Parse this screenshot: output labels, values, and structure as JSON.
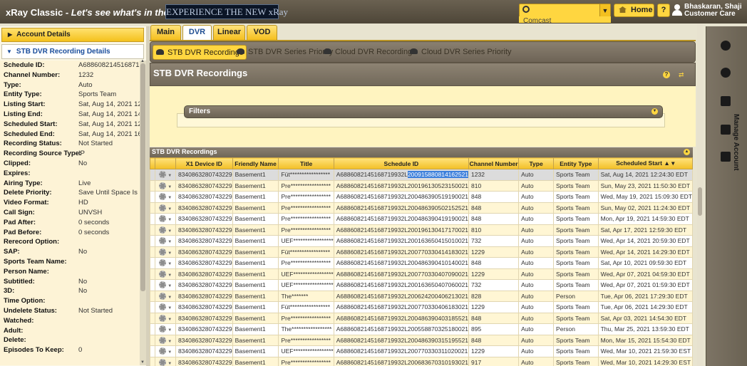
{
  "topbar": {
    "app_name": "xRay Classic",
    "tagline": "Let's see what's in there",
    "banner": "EXPERIENCE THE NEW xRay",
    "search_value": "",
    "search_sub": "Comcast",
    "home_label": "Home",
    "help_label": "?",
    "user_name": "Bhaskaran, Shaji",
    "user_role": "Customer Care"
  },
  "sidebar": {
    "account_label": "Account Details",
    "section_label": "STB DVR Recording Details",
    "details": [
      {
        "label": "Schedule ID:",
        "value": "A6886082145168719..."
      },
      {
        "label": "Channel Number:",
        "value": "1232"
      },
      {
        "label": "Type:",
        "value": "Auto"
      },
      {
        "label": "Entity Type:",
        "value": "Sports Team"
      },
      {
        "label": "Listing Start:",
        "value": "Sat, Aug 14, 2021 12:..."
      },
      {
        "label": "Listing End:",
        "value": "Sat, Aug 14, 2021 14:..."
      },
      {
        "label": "Scheduled Start:",
        "value": "Sat, Aug 14, 2021 12:..."
      },
      {
        "label": "Scheduled End:",
        "value": "Sat, Aug 14, 2021 16:..."
      },
      {
        "label": "Recording Status:",
        "value": "Not Started"
      },
      {
        "label": "Recording Source Type:",
        "value": "IP"
      },
      {
        "label": "Clipped:",
        "value": "No"
      },
      {
        "label": "Expires:",
        "value": ""
      },
      {
        "label": "Airing Type:",
        "value": "Live"
      },
      {
        "label": "Delete Priority:",
        "value": "Save Until Space Is Ne..."
      },
      {
        "label": "Video Format:",
        "value": "HD"
      },
      {
        "label": "Call Sign:",
        "value": "UNVSH"
      },
      {
        "label": "Pad After:",
        "value": "0 seconds"
      },
      {
        "label": "Pad Before:",
        "value": "0 seconds"
      },
      {
        "label": "Rerecord Option:",
        "value": ""
      },
      {
        "label": "SAP:",
        "value": "No"
      },
      {
        "label": "Sports Team Name:",
        "value": ""
      },
      {
        "label": "Person Name:",
        "value": ""
      },
      {
        "label": "Subtitled:",
        "value": "No"
      },
      {
        "label": "3D:",
        "value": "No"
      },
      {
        "label": "Time Option:",
        "value": ""
      },
      {
        "label": "Undelete Status:",
        "value": "Not Started"
      },
      {
        "label": "Watched:",
        "value": ""
      },
      {
        "label": "Adult:",
        "value": ""
      },
      {
        "label": "Delete:",
        "value": ""
      },
      {
        "label": "Episodes To Keep:",
        "value": "0"
      }
    ]
  },
  "tabs": [
    {
      "label": "Main",
      "active": false
    },
    {
      "label": "DVR",
      "active": true
    },
    {
      "label": "Linear",
      "active": false
    },
    {
      "label": "VOD",
      "active": false
    }
  ],
  "subtabs": [
    {
      "label": "STB DVR Recordings",
      "active": true
    },
    {
      "label": "STB DVR Series Priority",
      "active": false
    },
    {
      "label": "Cloud DVR Recordings",
      "active": false
    },
    {
      "label": "Cloud DVR Series Priority",
      "active": false
    }
  ],
  "panel": {
    "title": "STB DVR Recordings",
    "filters_label": "Filters",
    "grid_title": "STB DVR Recordings"
  },
  "table": {
    "columns": [
      "",
      "X1 Device ID",
      "Friendly Name",
      "Title",
      "Schedule ID",
      "Channel Number",
      "Type",
      "Entity Type",
      "Scheduled Start"
    ],
    "sort_indicator": "▲ ▾",
    "rows": [
      [
        "8340863280743229",
        "Basement1",
        "Füt*****************",
        "A6886082145168719932L",
        "200915880814162521",
        "1232",
        "Auto",
        "Sports Team",
        "Sat, Aug 14, 2021 12:24:30 EDT"
      ],
      [
        "8340863280743229",
        "Basement1",
        "Pre*****************",
        "A6886082145168719932L200196130523150021",
        "",
        "810",
        "Auto",
        "Sports Team",
        "Sun, May 23, 2021 11:50:30 EDT"
      ],
      [
        "8340863280743229",
        "Basement1",
        "Pre*****************",
        "A6886082145168719932L200486390519190021",
        "",
        "848",
        "Auto",
        "Sports Team",
        "Wed, May 19, 2021 15:09:30 EDT"
      ],
      [
        "8340863280743229",
        "Basement1",
        "Pre*****************",
        "A6886082145168719932L200486390502152521",
        "",
        "848",
        "Auto",
        "Sports Team",
        "Sun, May 02, 2021 11:24:30 EDT"
      ],
      [
        "8340863280743229",
        "Basement1",
        "Pre*****************",
        "A6886082145168719932L200486390419190021",
        "",
        "848",
        "Auto",
        "Sports Team",
        "Mon, Apr 19, 2021 14:59:30 EDT"
      ],
      [
        "8340863280743229",
        "Basement1",
        "Pre*****************",
        "A6886082145168719932L200196130417170021",
        "",
        "810",
        "Auto",
        "Sports Team",
        "Sat, Apr 17, 2021 12:59:30 EDT"
      ],
      [
        "8340863280743229",
        "Basement1",
        "UEF*****************",
        "A6886082145168719932L200163650415010021",
        "",
        "732",
        "Auto",
        "Sports Team",
        "Wed, Apr 14, 2021 20:59:30 EDT"
      ],
      [
        "8340863280743229",
        "Basement1",
        "Füt*****************",
        "A6886082145168719932L200770330414183021",
        "",
        "1229",
        "Auto",
        "Sports Team",
        "Wed, Apr 14, 2021 14:29:30 EDT"
      ],
      [
        "8340863280743229",
        "Basement1",
        "Pre*****************",
        "A6886082145168719932L200486390410140021",
        "",
        "848",
        "Auto",
        "Sports Team",
        "Sat, Apr 10, 2021 09:59:30 EDT"
      ],
      [
        "8340863280743229",
        "Basement1",
        "UEF*****************",
        "A6886082145168719932L200770330407090021",
        "",
        "1229",
        "Auto",
        "Sports Team",
        "Wed, Apr 07, 2021 04:59:30 EDT"
      ],
      [
        "8340863280743229",
        "Basement1",
        "UEF*****************",
        "A6886082145168719932L200163650407060021",
        "",
        "732",
        "Auto",
        "Sports Team",
        "Wed, Apr 07, 2021 01:59:30 EDT"
      ],
      [
        "8340863280743229",
        "Basement1",
        "The*******",
        "A6886082145168719932L200624200406213021",
        "",
        "828",
        "Auto",
        "Person",
        "Tue, Apr 06, 2021 17:29:30 EDT"
      ],
      [
        "8340863280743229",
        "Basement1",
        "Füt*****************",
        "A6886082145168719932L200770330406183021",
        "",
        "1229",
        "Auto",
        "Sports Team",
        "Tue, Apr 06, 2021 14:29:30 EDT"
      ],
      [
        "8340863280743229",
        "Basement1",
        "Pre*****************",
        "A6886082145168719932L200486390403185521",
        "",
        "848",
        "Auto",
        "Sports Team",
        "Sat, Apr 03, 2021 14:54:30 EDT"
      ],
      [
        "8340863280743229",
        "Basement1",
        "The*****************",
        "A6886082145168719932L200558870325180021",
        "",
        "895",
        "Auto",
        "Person",
        "Thu, Mar 25, 2021 13:59:30 EDT"
      ],
      [
        "8340863280743229",
        "Basement1",
        "Pre*****************",
        "A6886082145168719932L200486390315195521",
        "",
        "848",
        "Auto",
        "Sports Team",
        "Mon, Mar 15, 2021 15:54:30 EDT"
      ],
      [
        "8340863280743229",
        "Basement1",
        "UEF*****************",
        "A6886082145168719932L200770330311020021",
        "",
        "1229",
        "Auto",
        "Sports Team",
        "Wed, Mar 10, 2021 21:59:30 EST"
      ],
      [
        "8340863280743229",
        "Basement1",
        "Pre*****************",
        "A6886082145168719932L200683670310193021",
        "",
        "917",
        "Auto",
        "Sports Team",
        "Wed, Mar 10, 2021 14:29:30 EST"
      ]
    ]
  },
  "right_rail": {
    "label": "Manage Account",
    "icons": [
      "account-circle-icon",
      "no-entry-icon",
      "monitor-icon",
      "exit-icon",
      "house-icon"
    ]
  },
  "colors": {
    "accent": "#ffd640",
    "header_bg": "#6a6151",
    "link_blue": "#1a4d9b",
    "highlight": "#3c7fdb"
  }
}
